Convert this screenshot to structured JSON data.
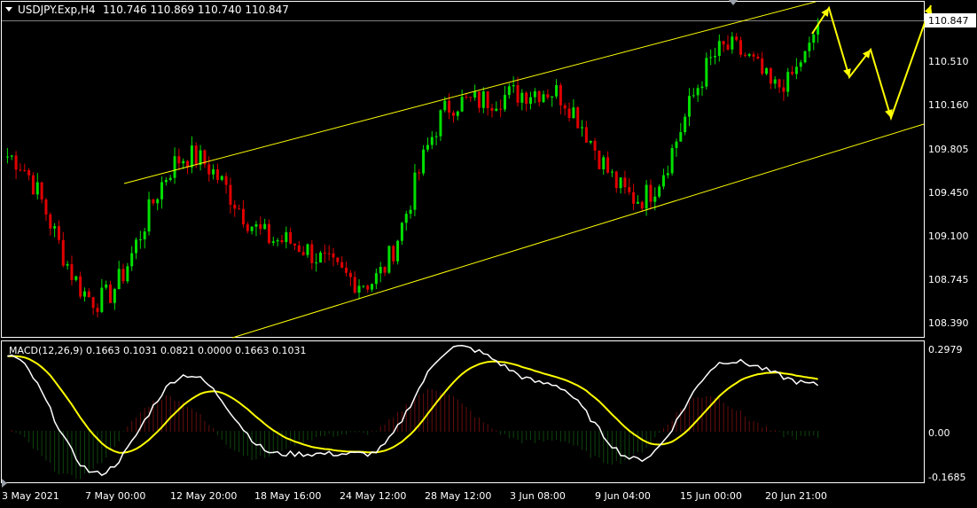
{
  "main_panel": {
    "symbol": "USDJPY.Exp,H4",
    "ohlc": "110.746 110.869 110.740 110.847",
    "price_axis_ticks": [
      "110.510",
      "110.160",
      "109.805",
      "109.450",
      "109.100",
      "108.745",
      "108.390"
    ],
    "current_price_label": "110.847"
  },
  "macd_panel": {
    "label": "MACD(12,26,9) 0.1663 0.1031 0.0821 0.0000 0.1663 0.1031",
    "axis_ticks": [
      "0.2979",
      "0.00",
      "-0.1685"
    ]
  },
  "time_axis": {
    "labels": [
      "3 May 2021",
      "7 May 00:00",
      "12 May 20:00",
      "18 May 16:00",
      "24 May 12:00",
      "28 May 12:00",
      "3 Jun 08:00",
      "9 Jun 04:00",
      "15 Jun 00:00",
      "20 Jun 21:00"
    ]
  },
  "colors": {
    "background": "#000000",
    "bull_candle": "#00e000",
    "bear_candle": "#e00000",
    "channel_line": "#ffff00",
    "forecast_arrow": "#ffff00",
    "macd_line": "#ffffff",
    "signal_line": "#ffff00",
    "grid_border": "#ffffff",
    "hist_pos": "#cc1a1a",
    "hist_neg": "#1a8a1a"
  },
  "icons": {
    "menu": "triangle-down-icon"
  },
  "chart_data": {
    "type": "candlestick",
    "instrument": "USDJPY",
    "timeframe": "H4",
    "ylim": [
      108.28,
      110.98
    ],
    "key_levels": [
      {
        "date": "3 May 2021",
        "value": 109.75
      },
      {
        "date": "7 May 00:00",
        "value": 108.55
      },
      {
        "date": "12 May 20:00",
        "value": 109.75
      },
      {
        "date": "18 May 16:00",
        "value": 109.05
      },
      {
        "date": "24 May 12:00",
        "value": 108.7
      },
      {
        "date": "28 May 12:00",
        "value": 110.2
      },
      {
        "date": "3 Jun 08:00",
        "value": 110.3
      },
      {
        "date": "9 Jun 04:00",
        "value": 109.4
      },
      {
        "date": "15 Jun 00:00",
        "value": 110.65
      },
      {
        "date": "20 Jun 21:00",
        "value": 109.95
      }
    ],
    "macd": {
      "params": "12,26,9",
      "ylim": [
        -0.1685,
        0.2979
      ]
    }
  }
}
